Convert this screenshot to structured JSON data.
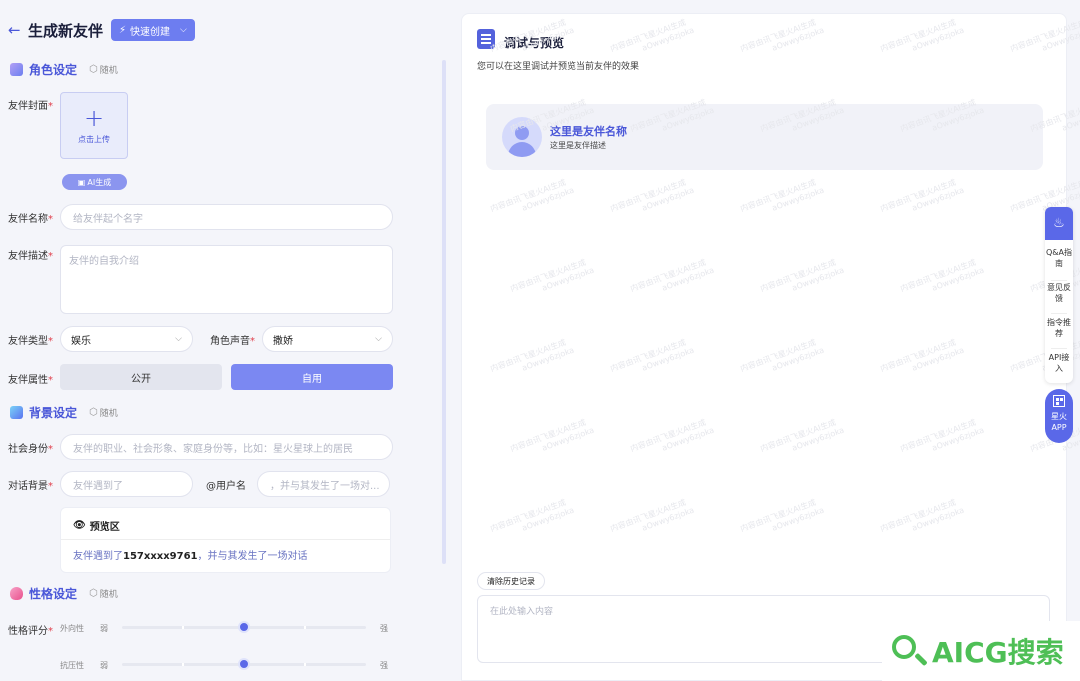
{
  "header": {
    "title": "生成新友伴",
    "quick_label": "快速创建"
  },
  "sections": {
    "role": "角色设定",
    "background": "背景设定",
    "personality": "性格设定",
    "random": "随机"
  },
  "colors": {
    "accent": "#5a68e8",
    "brand_green": "#4ebf56",
    "required": "#e0404c"
  },
  "form": {
    "cover_label": "友伴封面",
    "upload_text": "点击上传",
    "ai_generate": "AI生成",
    "name_label": "友伴名称",
    "name_placeholder": "给友伴起个名字",
    "desc_label": "友伴描述",
    "desc_placeholder": "友伴的自我介绍",
    "type_label": "友伴类型",
    "type_value": "娱乐",
    "voice_label": "角色声音",
    "voice_value": "撒娇",
    "attr_label": "友伴属性",
    "attr_public": "公开",
    "attr_private": "自用",
    "identity_label": "社会身份",
    "identity_placeholder": "友伴的职业、社会形象、家庭身份等，比如：星火星球上的居民",
    "dialog_label": "对话背景",
    "dialog_placeholder": "友伴遇到了",
    "at_user": "@用户名",
    "dialog_placeholder2": "，并与其发生了一场对...",
    "preview_title": "预览区",
    "preview_prefix": "友伴遇到了",
    "preview_user": "157xxxx9761",
    "preview_suffix": "，并与其发生了一场对话",
    "score_label": "性格评分",
    "sliders": [
      {
        "name": "外向性",
        "weak": "弱",
        "strong": "强",
        "value": 0.5
      },
      {
        "name": "抗压性",
        "weak": "弱",
        "strong": "强",
        "value": 0.5
      }
    ]
  },
  "preview_panel": {
    "title": "调试与预览",
    "subtitle": "您可以在这里调试并预览当前友伴的效果",
    "companion_name": "这里是友伴名称",
    "companion_desc": "这里是友伴描述",
    "clear_history": "清除历史记录",
    "input_placeholder": "在此处输入内容"
  },
  "side_bar": {
    "items": [
      "Q&A指南",
      "意见反馈",
      "指令推荐",
      "API接入"
    ],
    "app_label": "星火APP"
  },
  "watermark": {
    "line1": "内容由讯飞星火AI生成",
    "line2": "aOwwy6zjoka"
  },
  "logo": "AICG搜索"
}
